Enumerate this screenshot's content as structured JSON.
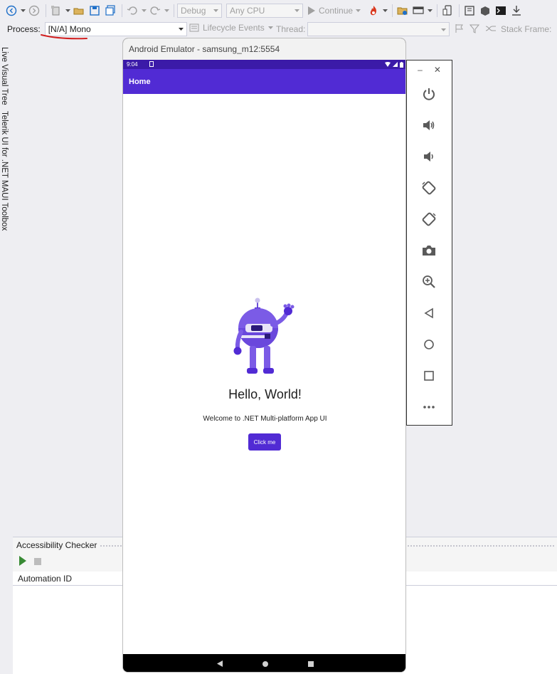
{
  "toolbar": {
    "config": "Debug",
    "platform": "Any CPU",
    "continue_label": "Continue"
  },
  "debug_bar": {
    "process_label": "Process:",
    "process_value": "[N/A] Mono",
    "lifecycle_label": "Lifecycle Events",
    "thread_label": "Thread:",
    "stack_frame_label": "Stack Frame:"
  },
  "left_tabs": [
    "Live Visual Tree",
    "Telerik UI for .NET MAUI Toolbox"
  ],
  "emulator": {
    "window_title": "Android Emulator - samsung_m12:5554",
    "status_time": "9:04",
    "app_title": "Home",
    "hello_text": "Hello, World!",
    "welcome_text": "Welcome to .NET Multi-platform App UI",
    "button_label": "Click me",
    "accent": "#512bd4"
  },
  "emulator_controls": {
    "minimize": "–",
    "close": "✕",
    "items": [
      "power-icon",
      "volume-up-icon",
      "volume-down-icon",
      "rotate-left-icon",
      "rotate-right-icon",
      "camera-icon",
      "zoom-icon",
      "back-icon",
      "home-icon",
      "overview-icon",
      "more-icon"
    ]
  },
  "accessibility_checker": {
    "title": "Accessibility Checker",
    "column_header": "Automation ID"
  }
}
